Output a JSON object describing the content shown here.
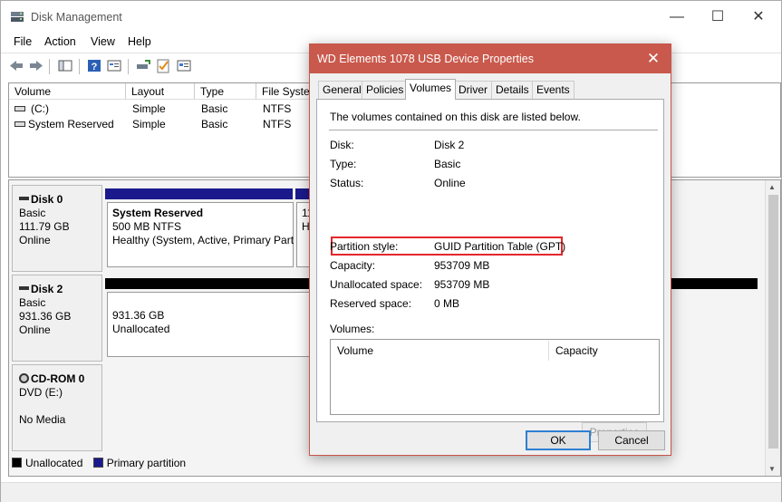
{
  "window": {
    "title": "Disk Management",
    "minimize": "—",
    "maximize": "☐",
    "close": "✕"
  },
  "menu": [
    "File",
    "Action",
    "View",
    "Help"
  ],
  "volume_list": {
    "columns": [
      "Volume",
      "Layout",
      "Type",
      "File System"
    ],
    "rows": [
      {
        "volume": "(C:)",
        "layout": "Simple",
        "type": "Basic",
        "fs": "NTFS"
      },
      {
        "volume": "System Reserved",
        "layout": "Simple",
        "type": "Basic",
        "fs": "NTFS"
      }
    ]
  },
  "disks": [
    {
      "name": "Disk 0",
      "type": "Basic",
      "size": "111.79 GB",
      "status": "Online",
      "partitions": [
        {
          "title": "System Reserved",
          "size": "500 MB NTFS",
          "status": "Healthy (System, Active, Primary Part"
        },
        {
          "title": "",
          "size": "11",
          "status": "H"
        }
      ]
    },
    {
      "name": "Disk 2",
      "type": "Basic",
      "size": "931.36 GB",
      "status": "Online",
      "partitions": [
        {
          "title": "",
          "size": "931.36 GB",
          "status": "Unallocated"
        }
      ]
    },
    {
      "name": "CD-ROM 0",
      "type": "DVD (E:)",
      "size": "",
      "status": "No Media",
      "partitions": []
    }
  ],
  "legend": [
    {
      "label": "Unallocated",
      "color": "#000000"
    },
    {
      "label": "Primary partition",
      "color": "#1a1a8c"
    }
  ],
  "dialog": {
    "title": "WD Elements 1078 USB Device Properties",
    "close": "✕",
    "tabs": [
      "General",
      "Policies",
      "Volumes",
      "Driver",
      "Details",
      "Events"
    ],
    "active_tab": "Volumes",
    "intro": "The volumes contained on this disk are listed below.",
    "fields": [
      {
        "label": "Disk:",
        "value": "Disk 2"
      },
      {
        "label": "Type:",
        "value": "Basic"
      },
      {
        "label": "Status:",
        "value": "Online"
      },
      {
        "label": "Partition style:",
        "value": "GUID Partition Table (GPT)"
      },
      {
        "label": "Capacity:",
        "value": "953709 MB"
      },
      {
        "label": "Unallocated space:",
        "value": "953709 MB"
      },
      {
        "label": "Reserved space:",
        "value": "0 MB"
      }
    ],
    "volumes_label": "Volumes:",
    "volumes_columns": [
      "Volume",
      "Capacity"
    ],
    "properties_button": "Properties",
    "ok_button": "OK",
    "cancel_button": "Cancel",
    "highlight_color": "#e4272a",
    "title_color": "#c9594c"
  }
}
